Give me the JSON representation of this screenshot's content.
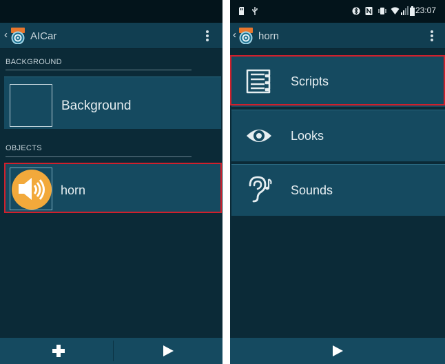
{
  "left_screen": {
    "app_title": "AICar",
    "sections": {
      "background_header": "BACKGROUND",
      "objects_header": "OBJECTS"
    },
    "background_tile": {
      "label": "Background"
    },
    "object_tile": {
      "label": "horn",
      "icon": "speaker-icon"
    },
    "bottom_bar": {
      "add_icon": "plus-icon",
      "play_icon": "play-icon"
    }
  },
  "right_screen": {
    "status_bar": {
      "time": "23:07"
    },
    "title": "horn",
    "menu": [
      {
        "label": "Scripts",
        "icon": "scripts-list-icon"
      },
      {
        "label": "Looks",
        "icon": "eye-icon"
      },
      {
        "label": "Sounds",
        "icon": "ear-icon"
      }
    ],
    "bottom_bar": {
      "play_icon": "play-icon"
    }
  },
  "colors": {
    "background": "#0b2a37",
    "tile": "#154a60",
    "action_bar": "#113e51",
    "highlight": "#d0202c",
    "speaker_badge": "#f2a93b"
  }
}
